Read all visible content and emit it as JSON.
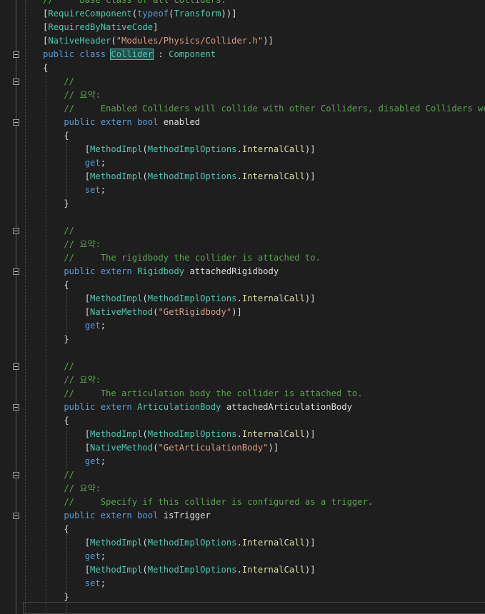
{
  "editor": {
    "language": "csharp",
    "lines": [
      [
        [
          "cm",
          "//     Base class of all colliders."
        ]
      ],
      [
        [
          "pl",
          "["
        ],
        [
          "ty",
          "RequireComponent"
        ],
        [
          "pl",
          "("
        ],
        [
          "kw",
          "typeof"
        ],
        [
          "pl",
          "("
        ],
        [
          "ty",
          "Transform"
        ],
        [
          "pl",
          "))]"
        ]
      ],
      [
        [
          "pl",
          "["
        ],
        [
          "ty",
          "RequiredByNativeCode"
        ],
        [
          "pl",
          "]"
        ]
      ],
      [
        [
          "pl",
          "["
        ],
        [
          "ty",
          "NativeHeader"
        ],
        [
          "pl",
          "("
        ],
        [
          "st",
          "\"Modules/Physics/Collider.h\""
        ],
        [
          "pl",
          ")]"
        ]
      ],
      [
        [
          "kw",
          "public class "
        ],
        [
          "hl",
          "Collider"
        ],
        [
          "pl",
          " : "
        ],
        [
          "ty",
          "Component"
        ]
      ],
      [
        [
          "pl",
          "{"
        ]
      ],
      [
        [
          "cm",
          "    //"
        ]
      ],
      [
        [
          "cm",
          "    // 요약:"
        ]
      ],
      [
        [
          "cm",
          "    //     Enabled Colliders will collide with other Colliders, disabled Colliders won't."
        ]
      ],
      [
        [
          "kw",
          "    public extern bool "
        ],
        [
          "pl",
          "enabled"
        ]
      ],
      [
        [
          "pl",
          "    {"
        ]
      ],
      [
        [
          "pl",
          "        ["
        ],
        [
          "ty",
          "MethodImpl"
        ],
        [
          "pl",
          "("
        ],
        [
          "ty",
          "MethodImplOptions"
        ],
        [
          "pl",
          "."
        ],
        [
          "me",
          "InternalCall"
        ],
        [
          "pl",
          ")]"
        ]
      ],
      [
        [
          "kw",
          "        get"
        ],
        [
          "pl",
          ";"
        ]
      ],
      [
        [
          "pl",
          "        ["
        ],
        [
          "ty",
          "MethodImpl"
        ],
        [
          "pl",
          "("
        ],
        [
          "ty",
          "MethodImplOptions"
        ],
        [
          "pl",
          "."
        ],
        [
          "me",
          "InternalCall"
        ],
        [
          "pl",
          ")]"
        ]
      ],
      [
        [
          "kw",
          "        set"
        ],
        [
          "pl",
          ";"
        ]
      ],
      [
        [
          "pl",
          "    }"
        ]
      ],
      [
        [
          "pl",
          ""
        ]
      ],
      [
        [
          "cm",
          "    //"
        ]
      ],
      [
        [
          "cm",
          "    // 요약:"
        ]
      ],
      [
        [
          "cm",
          "    //     The rigidbody the collider is attached to."
        ]
      ],
      [
        [
          "kw",
          "    public extern "
        ],
        [
          "ty",
          "Rigidbody"
        ],
        [
          "pl",
          " attachedRigidbody"
        ]
      ],
      [
        [
          "pl",
          "    {"
        ]
      ],
      [
        [
          "pl",
          "        ["
        ],
        [
          "ty",
          "MethodImpl"
        ],
        [
          "pl",
          "("
        ],
        [
          "ty",
          "MethodImplOptions"
        ],
        [
          "pl",
          "."
        ],
        [
          "me",
          "InternalCall"
        ],
        [
          "pl",
          ")]"
        ]
      ],
      [
        [
          "pl",
          "        ["
        ],
        [
          "ty",
          "NativeMethod"
        ],
        [
          "pl",
          "("
        ],
        [
          "st",
          "\"GetRigidbody\""
        ],
        [
          "pl",
          ")]"
        ]
      ],
      [
        [
          "kw",
          "        get"
        ],
        [
          "pl",
          ";"
        ]
      ],
      [
        [
          "pl",
          "    }"
        ]
      ],
      [
        [
          "pl",
          ""
        ]
      ],
      [
        [
          "cm",
          "    //"
        ]
      ],
      [
        [
          "cm",
          "    // 요약:"
        ]
      ],
      [
        [
          "cm",
          "    //     The articulation body the collider is attached to."
        ]
      ],
      [
        [
          "kw",
          "    public extern "
        ],
        [
          "ty",
          "ArticulationBody"
        ],
        [
          "pl",
          " attachedArticulationBody"
        ]
      ],
      [
        [
          "pl",
          "    {"
        ]
      ],
      [
        [
          "pl",
          "        ["
        ],
        [
          "ty",
          "MethodImpl"
        ],
        [
          "pl",
          "("
        ],
        [
          "ty",
          "MethodImplOptions"
        ],
        [
          "pl",
          "."
        ],
        [
          "me",
          "InternalCall"
        ],
        [
          "pl",
          ")]"
        ]
      ],
      [
        [
          "pl",
          "        ["
        ],
        [
          "ty",
          "NativeMethod"
        ],
        [
          "pl",
          "("
        ],
        [
          "st",
          "\"GetArticulationBody\""
        ],
        [
          "pl",
          ")]"
        ]
      ],
      [
        [
          "kw",
          "        get"
        ],
        [
          "pl",
          ";"
        ]
      ],
      [
        [
          "cm",
          "    //"
        ]
      ],
      [
        [
          "cm",
          "    // 요약:"
        ]
      ],
      [
        [
          "cm",
          "    //     Specify if this collider is configured as a trigger."
        ]
      ],
      [
        [
          "kw",
          "    public extern bool "
        ],
        [
          "pl",
          "isTrigger"
        ]
      ],
      [
        [
          "pl",
          "    {"
        ]
      ],
      [
        [
          "pl",
          "        ["
        ],
        [
          "ty",
          "MethodImpl"
        ],
        [
          "pl",
          "("
        ],
        [
          "ty",
          "MethodImplOptions"
        ],
        [
          "pl",
          "."
        ],
        [
          "me",
          "InternalCall"
        ],
        [
          "pl",
          ")]"
        ]
      ],
      [
        [
          "kw",
          "        get"
        ],
        [
          "pl",
          ";"
        ]
      ],
      [
        [
          "pl",
          "        ["
        ],
        [
          "ty",
          "MethodImpl"
        ],
        [
          "pl",
          "("
        ],
        [
          "ty",
          "MethodImplOptions"
        ],
        [
          "pl",
          "."
        ],
        [
          "me",
          "InternalCall"
        ],
        [
          "pl",
          ")]"
        ]
      ],
      [
        [
          "kw",
          "        set"
        ],
        [
          "pl",
          ";"
        ]
      ],
      [
        [
          "pl",
          "    }"
        ]
      ]
    ],
    "fold_lines": [
      4,
      6,
      9,
      17,
      20,
      27,
      30,
      35,
      38
    ]
  }
}
